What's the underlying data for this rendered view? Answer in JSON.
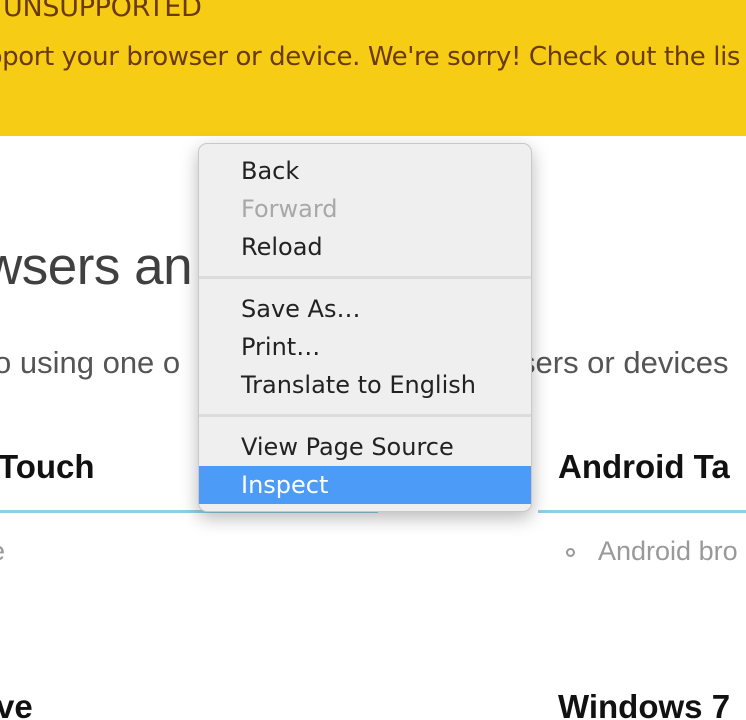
{
  "banner": {
    "title": "E UNSUPPORTED",
    "message": "pport your browser or device. We're sorry! Check out the lis",
    "color": "#f6cd14",
    "text_color": "#6b3a0a"
  },
  "page": {
    "heading": "wsers an",
    "lead_left": "o using one o",
    "lead_right": "sers or devices",
    "columns": [
      {
        "title": "Touch",
        "item": "e"
      },
      {
        "title": "Android Ta",
        "item": "Android bro"
      }
    ],
    "bottom_columns": [
      {
        "title": "ve"
      },
      {
        "title": "Windows 7"
      }
    ],
    "rule_color": "#8fd0e6"
  },
  "context_menu": {
    "highlight_color": "#4c9cf7",
    "groups": [
      [
        {
          "label": "Back",
          "enabled": true
        },
        {
          "label": "Forward",
          "enabled": false
        },
        {
          "label": "Reload",
          "enabled": true
        }
      ],
      [
        {
          "label": "Save As…",
          "enabled": true
        },
        {
          "label": "Print…",
          "enabled": true
        },
        {
          "label": "Translate to English",
          "enabled": true
        }
      ],
      [
        {
          "label": "View Page Source",
          "enabled": true
        },
        {
          "label": "Inspect",
          "enabled": true,
          "highlighted": true
        }
      ]
    ]
  }
}
